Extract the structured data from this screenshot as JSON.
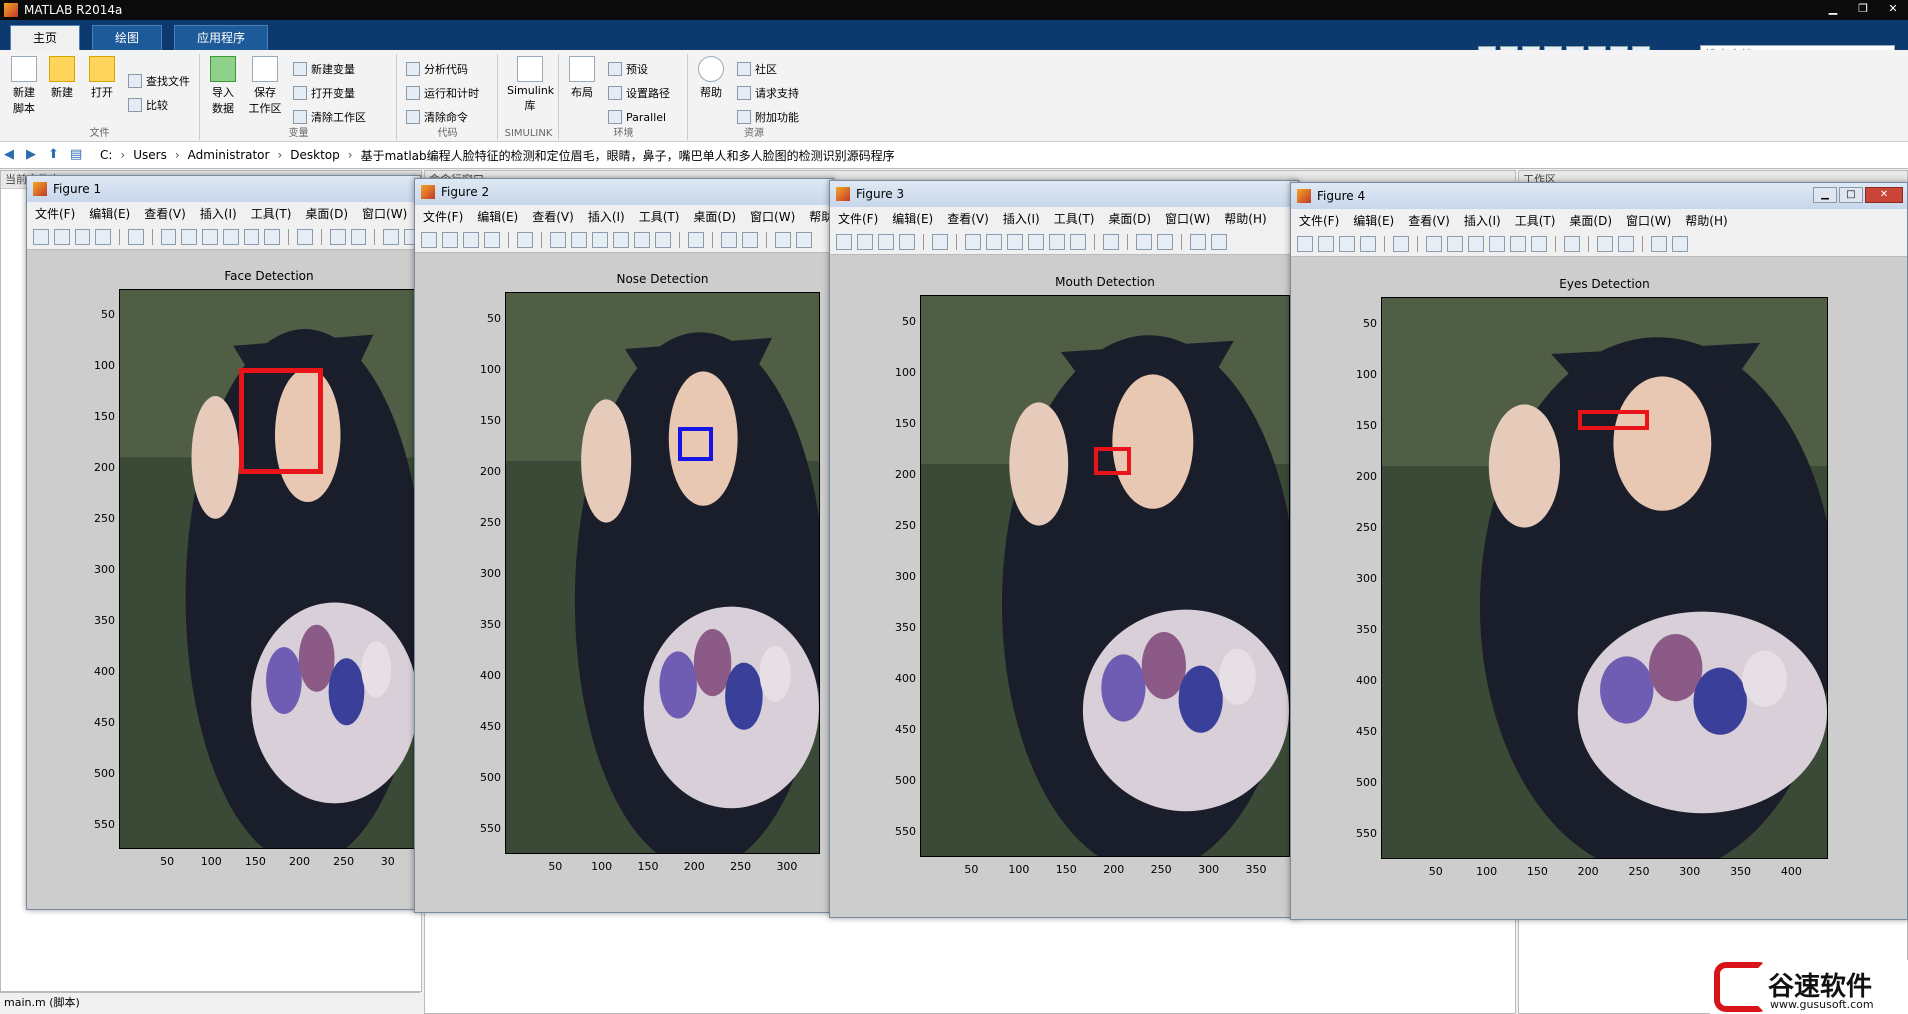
{
  "app": {
    "title": "MATLAB R2014a"
  },
  "main_tabs": [
    {
      "label": "主页"
    },
    {
      "label": "绘图"
    },
    {
      "label": "应用程序"
    }
  ],
  "search": {
    "placeholder": "搜索文档"
  },
  "toolstrip": {
    "file": {
      "label": "文件",
      "new_script": "新建\n脚本",
      "new": "新建",
      "open": "打开",
      "find_files": "查找文件",
      "compare": "比较"
    },
    "variable": {
      "label": "变量",
      "import": "导入\n数据",
      "save_ws": "保存\n工作区",
      "new_var": "新建变量",
      "open_var": "打开变量",
      "clear_ws": "清除工作区"
    },
    "code": {
      "label": "代码",
      "analyze": "分析代码",
      "run_time": "运行和计时",
      "clear_cmd": "清除命令"
    },
    "simulink": {
      "label": "SIMULINK",
      "simulink": "Simulink\n库"
    },
    "env": {
      "label": "环境",
      "layout": "布局",
      "prefs": "预设",
      "set_path": "设置路径",
      "parallel": "Parallel"
    },
    "resources": {
      "label": "资源",
      "help": "帮助",
      "community": "社区",
      "request_support": "请求支持",
      "addons": "附加功能"
    }
  },
  "address": {
    "crumbs": [
      "C:",
      "Users",
      "Administrator",
      "Desktop",
      "基于matlab编程人脸特征的检测和定位眉毛，眼睛，鼻子，嘴巴单人和多人脸图的检测识别源码程序"
    ]
  },
  "panels": {
    "current_folder": "当前文件夹",
    "command_window": "命令行窗口",
    "workspace": "工作区",
    "details": "main.m (脚本)"
  },
  "figure_menu": [
    "文件(F)",
    "编辑(E)",
    "查看(V)",
    "插入(I)",
    "工具(T)",
    "桌面(D)",
    "窗口(W)",
    "帮助(H)"
  ],
  "figures": [
    {
      "title": "Figure 1",
      "plot_title": "Face Detection",
      "box_color": "#e8141a",
      "x_ticks": [
        "50",
        "100",
        "150",
        "200",
        "250",
        "30"
      ]
    },
    {
      "title": "Figure 2",
      "plot_title": "Nose Detection",
      "box_color": "#1414e8",
      "x_ticks": [
        "50",
        "100",
        "150",
        "200",
        "250",
        "300"
      ]
    },
    {
      "title": "Figure 3",
      "plot_title": "Mouth Detection",
      "box_color": "#e8141a",
      "x_ticks": [
        "50",
        "100",
        "150",
        "200",
        "250",
        "300",
        "350"
      ]
    },
    {
      "title": "Figure 4",
      "plot_title": "Eyes Detection",
      "box_color": "#e8141a",
      "x_ticks": [
        "50",
        "100",
        "150",
        "200",
        "250",
        "300",
        "350",
        "400"
      ]
    }
  ],
  "y_ticks": [
    "50",
    "100",
    "150",
    "200",
    "250",
    "300",
    "350",
    "400",
    "450",
    "500",
    "550"
  ],
  "watermark": {
    "text": "谷速软件",
    "url": "www.gususoft.com"
  },
  "colors": {
    "matlab_tabbar": "#0d3a6e",
    "detection_red": "#e8141a",
    "detection_blue": "#1414e8"
  }
}
